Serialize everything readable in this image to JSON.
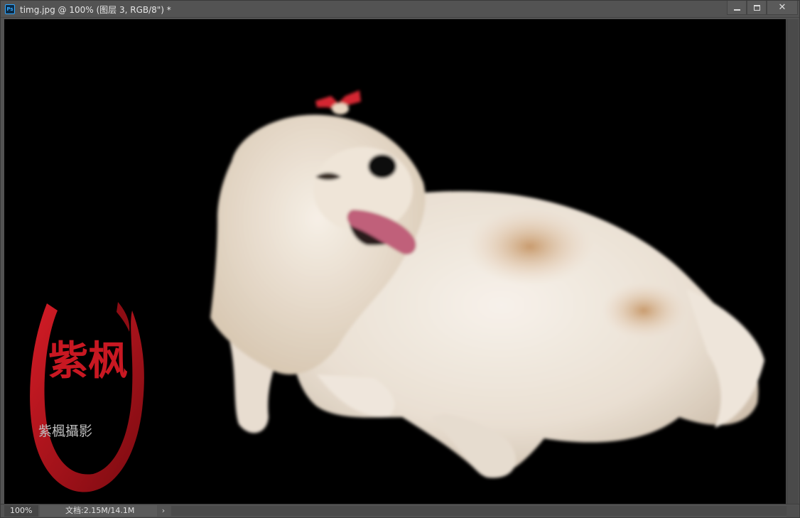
{
  "window": {
    "app_icon": "photoshop-icon",
    "app_icon_text": "Ps",
    "title": "timg.jpg @ 100% (图层 3, RGB/8\") *"
  },
  "controls": {
    "minimize_icon": "minimize-icon",
    "maximize_icon": "maximize-icon",
    "close_icon": "close-icon",
    "close_glyph": "✕"
  },
  "canvas": {
    "background": "#000000",
    "subject": "dog-photo",
    "watermark": {
      "text": "紫楓攝影",
      "calligraphy": "紫枫",
      "ring_color": "#b3101a"
    }
  },
  "status": {
    "zoom": "100%",
    "doc_info": "文档:2.15M/14.1M",
    "arrow": "›"
  }
}
